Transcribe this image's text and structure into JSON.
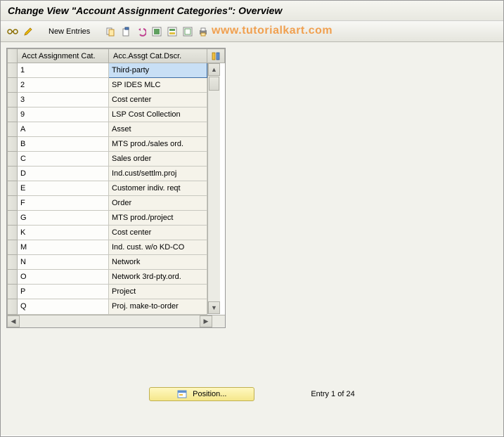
{
  "title": "Change View \"Account Assignment Categories\": Overview",
  "toolbar": {
    "new_entries_label": "New Entries"
  },
  "watermark": "www.tutorialkart.com",
  "table": {
    "col1_header": "Acct Assignment Cat.",
    "col2_header": "Acc.Assgt Cat.Dscr.",
    "rows": [
      {
        "cat": "1",
        "desc": "Third-party",
        "selected": true
      },
      {
        "cat": "2",
        "desc": "SP IDES MLC"
      },
      {
        "cat": "3",
        "desc": "Cost center"
      },
      {
        "cat": "9",
        "desc": "LSP Cost Collection"
      },
      {
        "cat": "A",
        "desc": "Asset"
      },
      {
        "cat": "B",
        "desc": "MTS prod./sales ord."
      },
      {
        "cat": "C",
        "desc": "Sales order"
      },
      {
        "cat": "D",
        "desc": "Ind.cust/settlm.proj"
      },
      {
        "cat": "E",
        "desc": "Customer indiv. reqt"
      },
      {
        "cat": "F",
        "desc": "Order"
      },
      {
        "cat": "G",
        "desc": "MTS prod./project"
      },
      {
        "cat": "K",
        "desc": "Cost center"
      },
      {
        "cat": "M",
        "desc": "Ind. cust. w/o KD-CO"
      },
      {
        "cat": "N",
        "desc": "Network"
      },
      {
        "cat": "O",
        "desc": "Network 3rd-pty.ord."
      },
      {
        "cat": "P",
        "desc": "Project"
      },
      {
        "cat": "Q",
        "desc": "Proj. make-to-order"
      }
    ]
  },
  "footer": {
    "position_label": "Position...",
    "entry_info": "Entry 1 of 24"
  }
}
